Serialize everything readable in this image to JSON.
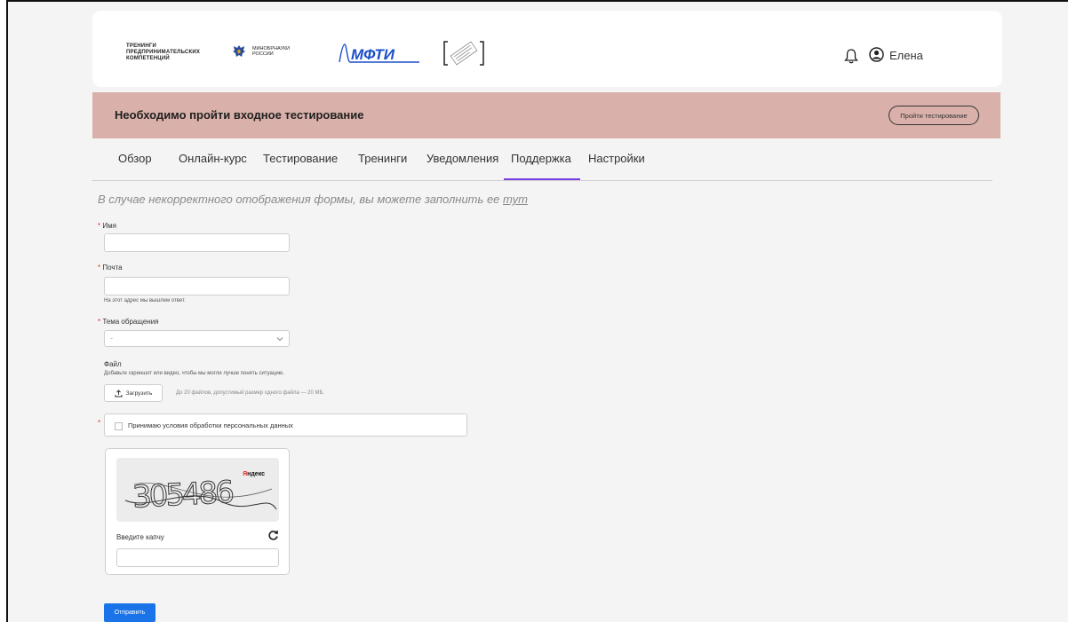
{
  "header": {
    "logo_trainings_lines": [
      "ТРЕНИНГИ",
      "ПРЕДПРИНИМАТЕЛЬСКИХ",
      "КОМПЕТЕНЦИЙ"
    ],
    "logo_minobr_lines": [
      "МИНОБРНАУКИ",
      "РОССИИ"
    ],
    "logo_mfti": "МФТИ",
    "user_name": "Елена"
  },
  "banner": {
    "text": "Необходимо пройти входное тестирование",
    "button_label": "Пройти тестирование",
    "color": "#d9b1aa"
  },
  "tabs": [
    {
      "label": "Обзор"
    },
    {
      "label": "Онлайн-курс"
    },
    {
      "label": "Тестирование"
    },
    {
      "label": "Тренинги"
    },
    {
      "label": "Уведомления"
    },
    {
      "label": "Поддержка"
    },
    {
      "label": "Настройки"
    }
  ],
  "active_tab": "Поддержка",
  "form": {
    "notice_text": "В случае некорректного отображения формы, вы можете заполнить ее ",
    "notice_link": "тут",
    "required_marker": "*",
    "name_label": "Имя",
    "email_label": "Почта",
    "email_hint": "На этот адрес мы вышлем ответ.",
    "topic_label": "Тема обращения",
    "topic_value": "-",
    "file_label": "Файл",
    "file_hint": "Добавьте скриншот или видео, чтобы мы могли лучше понять ситуацию.",
    "upload_label": "Загрузить",
    "upload_limits": "До 20 файлов, допустимый размер одного файла — 20 МБ.",
    "consent_label": "Принимаю условия обработки персональных данных",
    "captcha_code": "305486",
    "captcha_brand_first": "Я",
    "captcha_brand_rest": "ндекс",
    "captcha_label": "Введите капчу",
    "submit_label": "Отправить"
  },
  "colors": {
    "accent_tab": "#7b3fe4",
    "submit": "#1a73e8",
    "required": "#d9342b"
  }
}
